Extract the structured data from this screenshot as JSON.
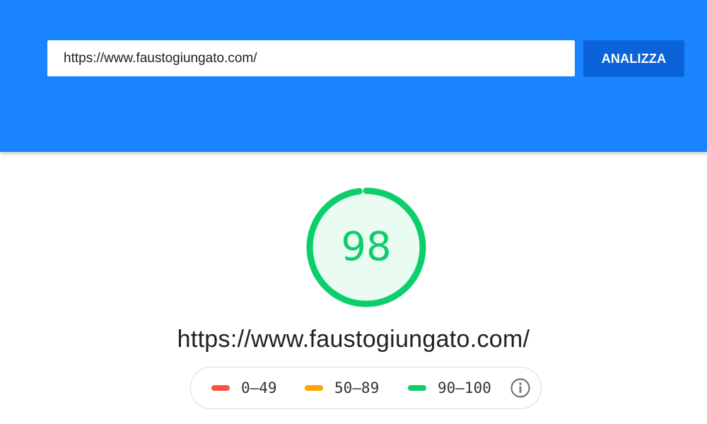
{
  "search": {
    "url_value": "https://www.faustogiungato.com/",
    "analyze_label": "ANALIZZA"
  },
  "score": {
    "value": "98",
    "fraction": 0.98,
    "color": "#0cce6b",
    "fill_color": "#eafbf2"
  },
  "report": {
    "tested_url": "https://www.faustogiungato.com/"
  },
  "legend": {
    "items": [
      {
        "label": "0–49",
        "color": "#ff4e42"
      },
      {
        "label": "50–89",
        "color": "#ffa400"
      },
      {
        "label": "90–100",
        "color": "#0cce6b"
      }
    ],
    "info_icon": "info-icon"
  },
  "colors": {
    "header_bg": "#1a84ff",
    "button_bg": "#0b63d9"
  }
}
